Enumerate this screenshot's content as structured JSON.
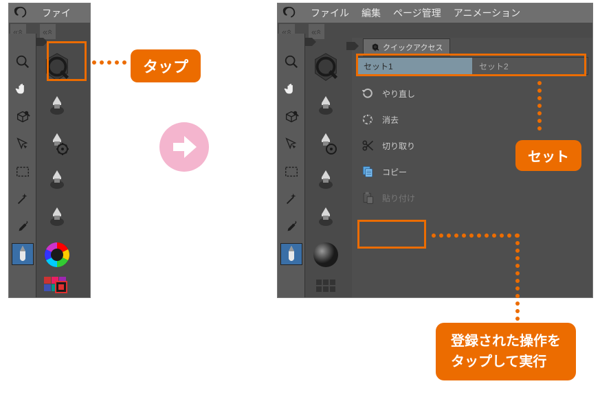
{
  "windows": {
    "left": {
      "menu_partial": "ファイ"
    },
    "right": {
      "menu_file": "ファイル",
      "menu_edit": "編集",
      "menu_page": "ページ管理",
      "menu_anim": "アニメーション"
    }
  },
  "quick_access": {
    "tab_label": "クイックアクセス",
    "set1": "セット1",
    "set2": "セット2",
    "actions": {
      "redo": "やり直し",
      "clear": "消去",
      "cut": "切り取り",
      "copy": "コピー",
      "paste": "貼り付け"
    }
  },
  "callouts": {
    "tap": "タップ",
    "set": "セット",
    "execute_line1": "登録された操作を",
    "execute_line2": "タップして実行"
  },
  "icons": {
    "magnify": "magnify-icon",
    "hand": "hand-icon",
    "cube": "cube-icon",
    "arrow_cursor": "cursor-icon",
    "marquee": "marquee-icon",
    "wand": "wand-icon",
    "eyedropper": "eyedropper-icon",
    "pen": "pen-icon",
    "color_wheel": "color-wheel-icon",
    "swatches": "swatches-icon"
  }
}
